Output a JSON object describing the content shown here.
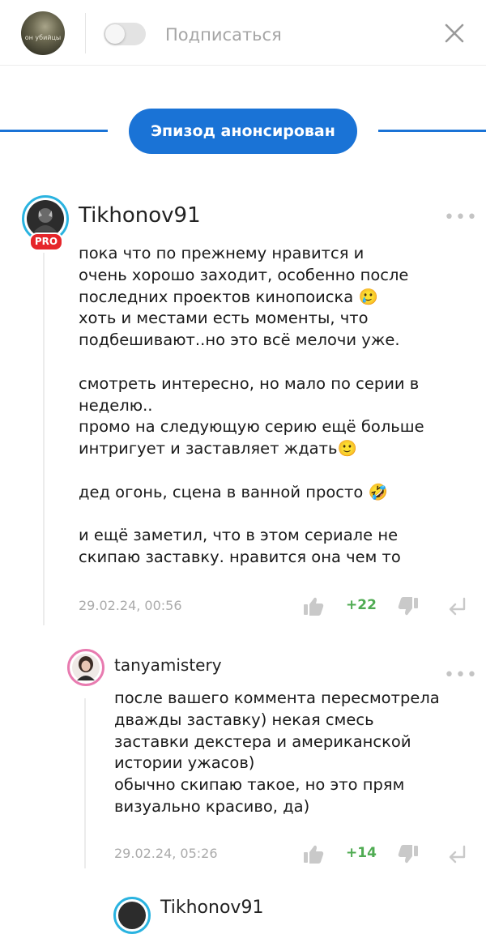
{
  "header": {
    "channel_avatar_caption": "он убийцы",
    "subscribe_label": "Подписаться",
    "icons": {
      "toggle": "toggle-switch",
      "close": "close-icon"
    }
  },
  "banner": {
    "label": "Эпизод анонсирован",
    "color": "#1a73d6"
  },
  "comments": [
    {
      "username": "Tikhonov91",
      "badge": "PRO",
      "text": "пока что по прежнему нравится и\nочень хорошо заходит, особенно после\nпоследних проектов кинопоиска 🥲\nхоть и местами есть моменты, что\nподбешивают..но это всё мелочи уже.\n\nсмотреть интересно, но мало по серии в\nнеделю..\nпромо на следующую серию ещё больше\nинтригует и заставляет ждать🙂\n\nдед огонь, сцена в ванной просто 🤣\n\nи ещё заметил, что в этом сериале не\nскипаю заставку. нравится она чем то",
      "timestamp": "29.02.24, 00:56",
      "votes": "+22"
    },
    {
      "username": "tanyamistery",
      "text": "после вашего коммента пересмотрела\nдважды заставку) некая смесь\nзаставки декстера и американской\nистории ужасов)\nобычно скипаю такое, но это прям\nвизуально красиво, да)",
      "timestamp": "29.02.24, 05:26",
      "votes": "+14"
    },
    {
      "username": "Tikhonov91"
    }
  ],
  "colors": {
    "accent": "#1a73d6",
    "positive": "#4fab52",
    "pro": "#e6262b",
    "ring_blue": "#2ab3e0",
    "ring_pink": "#e87bb0"
  }
}
